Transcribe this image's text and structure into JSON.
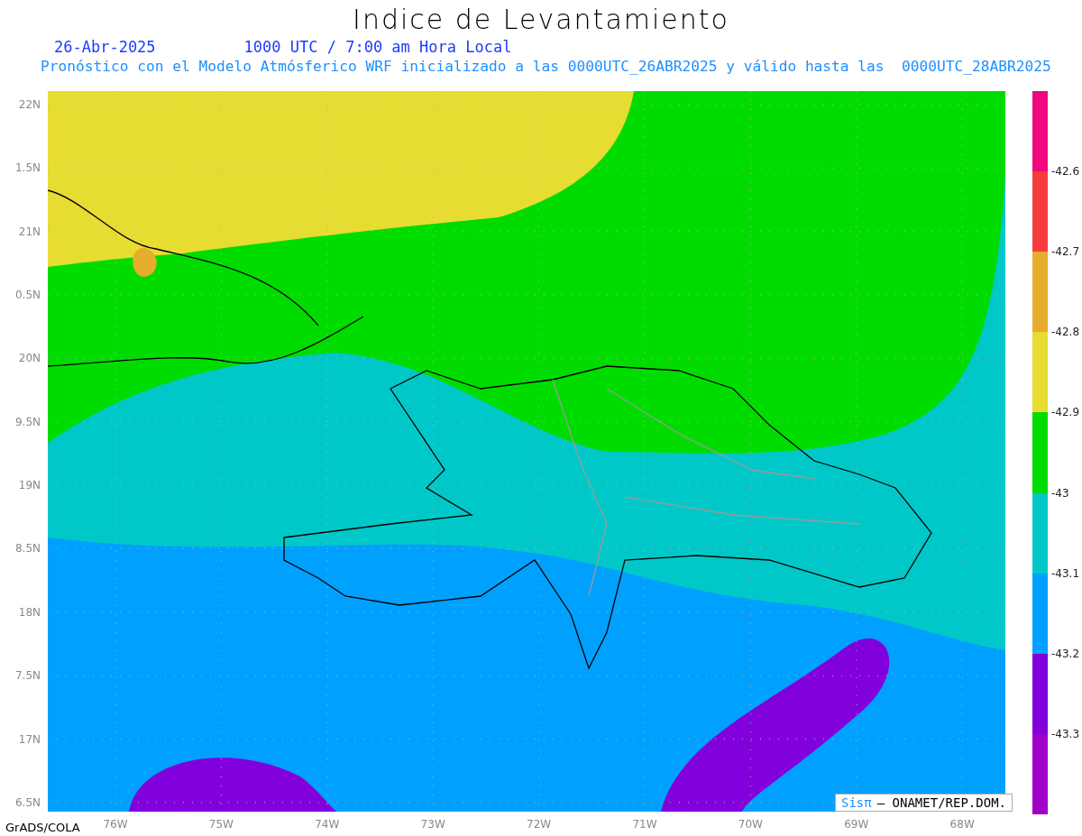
{
  "title": "Indice de Levantamiento",
  "date": "26-Abr-2025",
  "time": "1000 UTC / 7:00 am Hora Local",
  "subtitle": "Pronóstico con el Modelo Atmósferico WRF inicializado a las 0000UTC_26ABR2025 y válido hasta las  0000UTC_28ABR2025",
  "lat_labels": [
    "22N",
    "1.5N",
    "21N",
    "0.5N",
    "20N",
    "9.5N",
    "19N",
    "8.5N",
    "18N",
    "7.5N",
    "17N",
    "6.5N"
  ],
  "lon_labels": [
    "76W",
    "75W",
    "74W",
    "73W",
    "72W",
    "71W",
    "70W",
    "69W",
    "68W"
  ],
  "colorbar": {
    "segments": [
      {
        "color": "#f0087f"
      },
      {
        "color": "#f53c3c"
      },
      {
        "color": "#e6ac2e"
      },
      {
        "color": "#e6dc32"
      },
      {
        "color": "#00dc00"
      },
      {
        "color": "#00c8c8"
      },
      {
        "color": "#00a0ff"
      },
      {
        "color": "#8200dc"
      },
      {
        "color": "#a000c8"
      }
    ],
    "labels": [
      "-42.6",
      "-42.7",
      "-42.8",
      "-42.9",
      "-43",
      "-43.1",
      "-43.2",
      "-43.3"
    ]
  },
  "credit": {
    "brand": "Sisπ",
    "text": "– ONAMET/REP.DOM."
  },
  "footer": "GrADS/COLA"
}
